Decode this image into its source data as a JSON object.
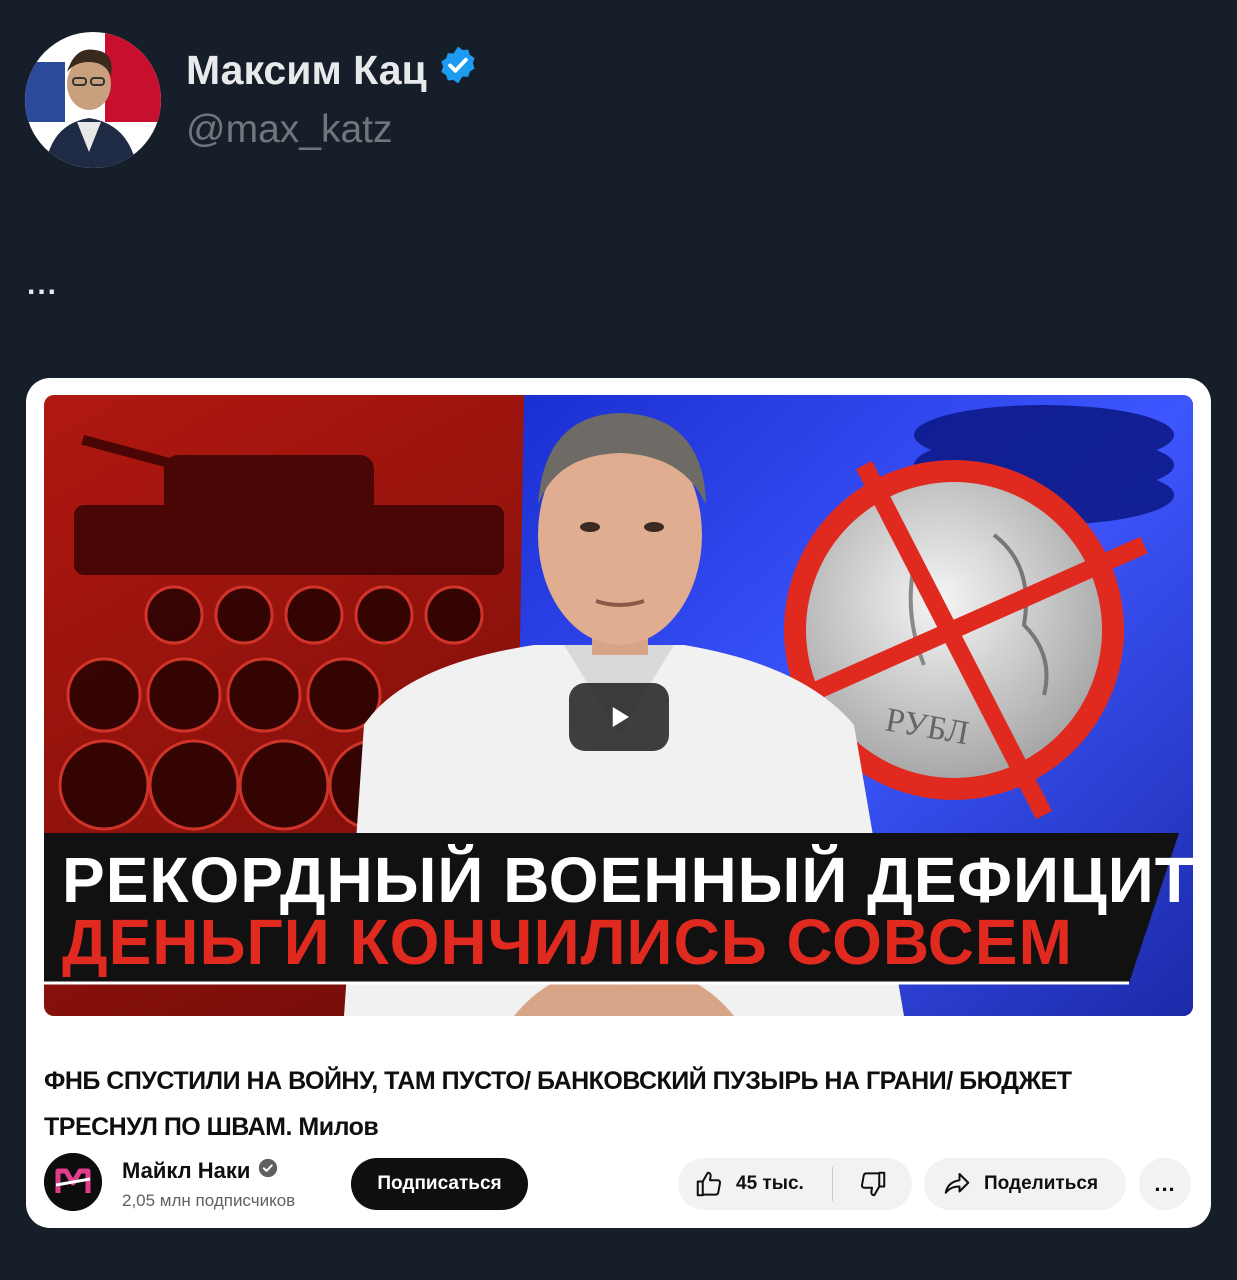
{
  "post": {
    "author_name": "Максим Кац",
    "author_handle": "@max_katz",
    "text": "..."
  },
  "video": {
    "thumbnail_line1": "РЕКОРДНЫЙ ВОЕННЫЙ ДЕФИЦИТ",
    "thumbnail_line2": "ДЕНЬГИ КОНЧИЛИСЬ СОВСЕМ",
    "coin_text": "РУБЛ",
    "title": "ФНБ СПУСТИЛИ НА ВОЙНУ, ТАМ ПУСТО/ БАНКОВСКИЙ ПУЗЫРЬ НА ГРАНИ/ БЮДЖЕТ ТРЕСНУЛ ПО ШВАМ. Милов"
  },
  "channel": {
    "name": "Майкл Наки",
    "subscribers": "2,05 млн подписчиков",
    "subscribe_label": "Подписаться"
  },
  "actions": {
    "like_count": "45 тыс.",
    "share_label": "Поделиться",
    "more_label": "..."
  },
  "colors": {
    "background": "#161e2a",
    "verified": "#1d9bf0",
    "banner_red": "#e02a1f"
  }
}
